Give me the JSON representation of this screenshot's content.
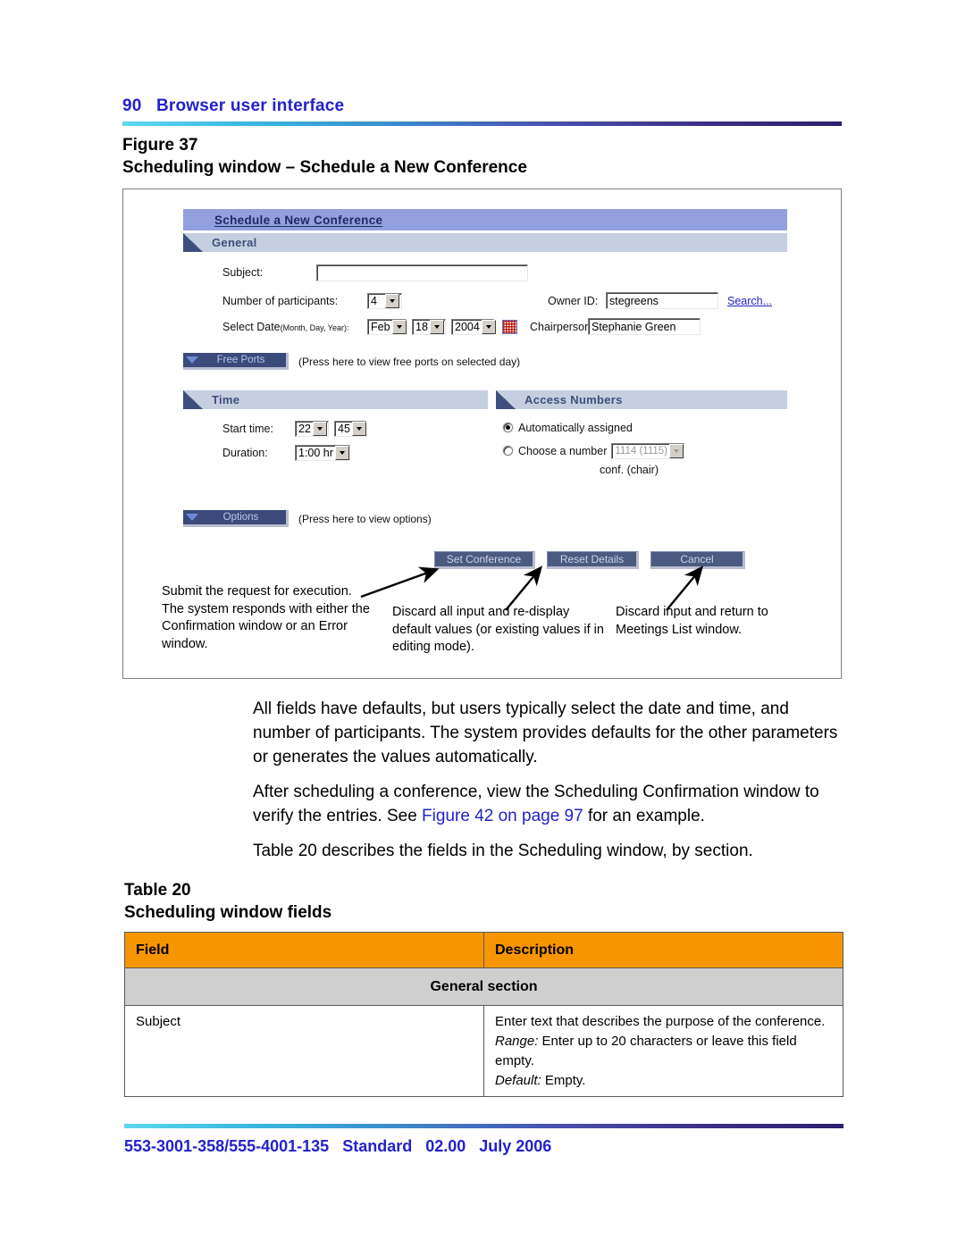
{
  "page": {
    "number": "90",
    "running_head": "Browser user interface",
    "header_line": "90   Browser user interface"
  },
  "figure": {
    "label": "Figure 37",
    "title": "Scheduling window – Schedule a New Conference"
  },
  "screenshot": {
    "window_title": "Schedule a New Conference",
    "sections": {
      "general": "General",
      "time": "Time",
      "access_numbers": "Access Numbers"
    },
    "general": {
      "subject_label": "Subject:",
      "subject_value": "",
      "participants_label": "Number of participants:",
      "participants_value": "4",
      "select_date_label": "Select Date",
      "select_date_hint": "(Month, Day, Year):",
      "date_month": "Feb",
      "date_day": "18",
      "date_year": "2004",
      "calendar_icon": "calendar-icon",
      "owner_id_label": "Owner ID:",
      "owner_id_value": "stegreens",
      "search_link": "Search...",
      "chairperson_label": "Chairperson:",
      "chairperson_value": "Stephanie Green"
    },
    "free_ports": {
      "button_label": "Free Ports",
      "hint": "(Press here to view free ports on selected day)"
    },
    "time": {
      "start_time_label": "Start time:",
      "start_hour": "22",
      "start_minute": "45",
      "duration_label": "Duration:",
      "duration_value": "1:00 hr"
    },
    "access": {
      "auto_label": "Automatically assigned",
      "auto_selected": true,
      "choose_label": "Choose a number",
      "choose_value": "1114 (1115)",
      "choose_caption": "conf. (chair)"
    },
    "options": {
      "button_label": "Options",
      "hint": "(Press here to view options)"
    },
    "buttons": {
      "set_conference": "Set Conference",
      "reset_details": "Reset Details",
      "cancel": "Cancel"
    },
    "callouts": {
      "set_conference": "Submit the request for execution. The system responds with either the Confirmation window or an Error window.",
      "reset_details": "Discard all input and re-display default values (or existing values if in editing mode).",
      "cancel": "Discard input and return to Meetings List window."
    }
  },
  "body": {
    "paragraph_1": "All fields have defaults, but users typically select the date and time, and number of participants. The system provides defaults for the other parameters or generates the values automatically.",
    "paragraph_2_before": "After scheduling a conference, view the Scheduling Confirmation window to verify the entries. See ",
    "paragraph_2_xref": "Figure 42 on page 97",
    "paragraph_2_after": " for an example.",
    "paragraph_3": "Table 20 describes the fields in the Scheduling window, by section."
  },
  "table": {
    "label": "Table 20",
    "title": "Scheduling window fields",
    "headers": [
      "Field",
      "Description"
    ],
    "section_row": "General section",
    "rows": [
      {
        "field": "Subject",
        "description_line_1": "Enter text that describes the purpose of the conference.",
        "range_label": "Range:",
        "range_value": " Enter up to 20 characters or leave this field empty.",
        "default_label": "Default:",
        "default_value": " Empty."
      }
    ]
  },
  "footer": {
    "text": "553-3001-358/555-4001-135   Standard   02.00   July 2006"
  },
  "colors": {
    "link": "#2222cc",
    "rule_gradient_start": "#5fd7f0",
    "rule_gradient_end": "#2d1f6e",
    "table_header": "#f79500",
    "table_section": "#cfcfcf",
    "window_title_bar": "#92a1dd",
    "section_bar": "#c5cfe0"
  }
}
